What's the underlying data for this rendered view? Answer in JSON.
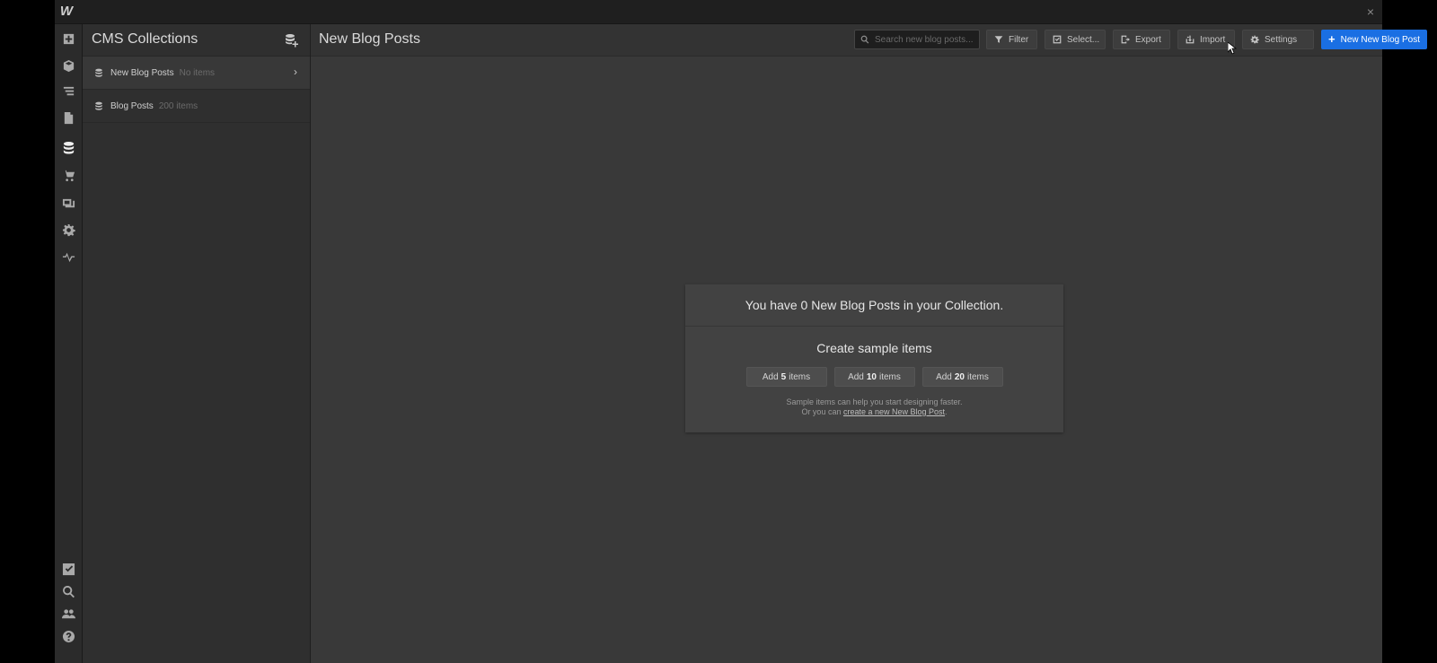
{
  "app": {
    "logo_text": "W",
    "close_glyph": "×"
  },
  "rail": {
    "top_icons": [
      "add-panel-icon",
      "components-icon",
      "navigator-icon",
      "pages-icon",
      "cms-icon",
      "ecommerce-icon",
      "assets-icon",
      "settings-icon",
      "audit-icon"
    ],
    "active": "cms-icon",
    "bottom_icons": [
      "tasks-icon",
      "search-icon",
      "users-icon",
      "help-icon"
    ]
  },
  "collections": {
    "title": "CMS Collections",
    "items": [
      {
        "name": "New Blog Posts",
        "count": "No items",
        "selected": true
      },
      {
        "name": "Blog Posts",
        "count": "200 items",
        "selected": false
      }
    ]
  },
  "main": {
    "title": "New Blog Posts",
    "search": {
      "placeholder": "Search new blog posts..."
    },
    "toolbar": {
      "filter": "Filter",
      "select": "Select...",
      "export": "Export",
      "import": "Import",
      "settings": "Settings",
      "new_item": "New New Blog Post"
    },
    "empty_state": {
      "message": "You have 0 New Blog Posts in your Collection.",
      "sample_title": "Create sample items",
      "buttons": [
        {
          "prefix": "Add",
          "count": "5",
          "suffix": "items"
        },
        {
          "prefix": "Add",
          "count": "10",
          "suffix": "items"
        },
        {
          "prefix": "Add",
          "count": "20",
          "suffix": "items"
        }
      ],
      "help_line1": "Sample items can help you start designing faster.",
      "help_line2_prefix": "Or you can",
      "help_link": "create a new New Blog Post",
      "help_line2_suffix": "."
    }
  },
  "colors": {
    "primary": "#1a6fe3",
    "background": "#393939",
    "panel": "#2f2f2f"
  }
}
